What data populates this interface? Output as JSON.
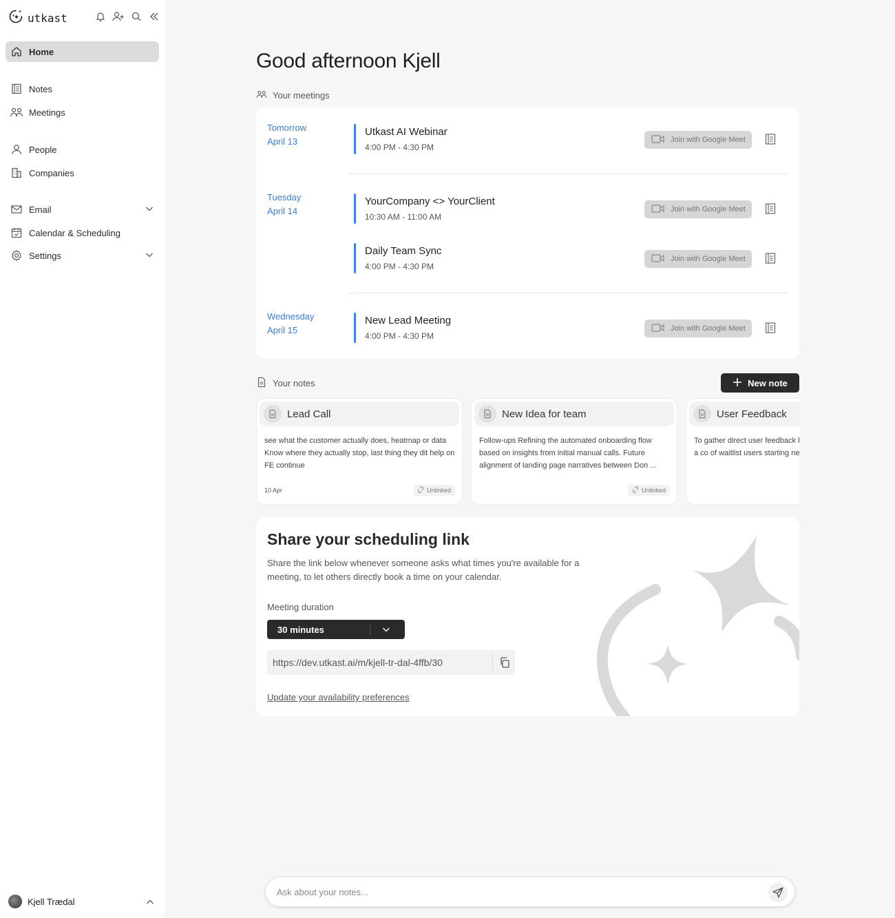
{
  "app": {
    "name": "utkast"
  },
  "sidebar": {
    "items": [
      {
        "key": "home",
        "label": "Home"
      },
      {
        "key": "notes",
        "label": "Notes"
      },
      {
        "key": "meetings",
        "label": "Meetings"
      },
      {
        "key": "people",
        "label": "People"
      },
      {
        "key": "companies",
        "label": "Companies"
      },
      {
        "key": "email",
        "label": "Email"
      },
      {
        "key": "calendar",
        "label": "Calendar & Scheduling"
      },
      {
        "key": "settings",
        "label": "Settings"
      }
    ],
    "user": {
      "name": "Kjell Trædal"
    }
  },
  "main": {
    "greeting": "Good afternoon Kjell",
    "meetings_label": "Your meetings",
    "days": [
      {
        "day": "Tomorrow",
        "date": "April 13"
      },
      {
        "day": "Tuesday",
        "date": "April 14"
      },
      {
        "day": "Wednesday",
        "date": "April 15"
      }
    ],
    "meetings": [
      {
        "title": "Utkast AI Webinar",
        "time": "4:00 PM - 4:30 PM",
        "join_label": "Join with Google Meet"
      },
      {
        "title": "YourCompany <> YourClient",
        "time": "10:30 AM - 11:00 AM",
        "join_label": "Join with Google Meet"
      },
      {
        "title": "Daily Team Sync",
        "time": "4:00 PM - 4:30 PM",
        "join_label": "Join with Google Meet"
      },
      {
        "title": "New Lead Meeting",
        "time": "4:00 PM - 4:30 PM",
        "join_label": "Join with Google Meet"
      }
    ],
    "notes_label": "Your notes",
    "new_note_label": "New note",
    "notes": [
      {
        "title": "Lead Call",
        "body": "see what the customer actually does, heatmap or data Know where they actually stop, last thing they dit help on FE continue",
        "date": "10 Apr",
        "status": "Unlinked"
      },
      {
        "title": "New Idea for team",
        "body": "Follow-ups Refining the automated onboarding flow based on insights from initial manual calls. Future alignment of landing page narratives between Don ...",
        "date": "",
        "status": "Unlinked"
      },
      {
        "title": "User Feedback",
        "body": "To gather direct user feedback before scaling. Implement a co of waitlist users starting next V",
        "date": "",
        "status": ""
      }
    ],
    "share": {
      "title": "Share your scheduling link",
      "description": "Share the link below whenever someone asks what times you're available for a meeting, to let others directly book a time on your calendar.",
      "duration_label": "Meeting duration",
      "duration_value": "30 minutes",
      "link": "https://dev.utkast.ai/m/kjell-tr-dal-4ffb/30",
      "availability_link": "Update your availability preferences"
    },
    "ask": {
      "placeholder": "Ask about your notes..."
    }
  }
}
